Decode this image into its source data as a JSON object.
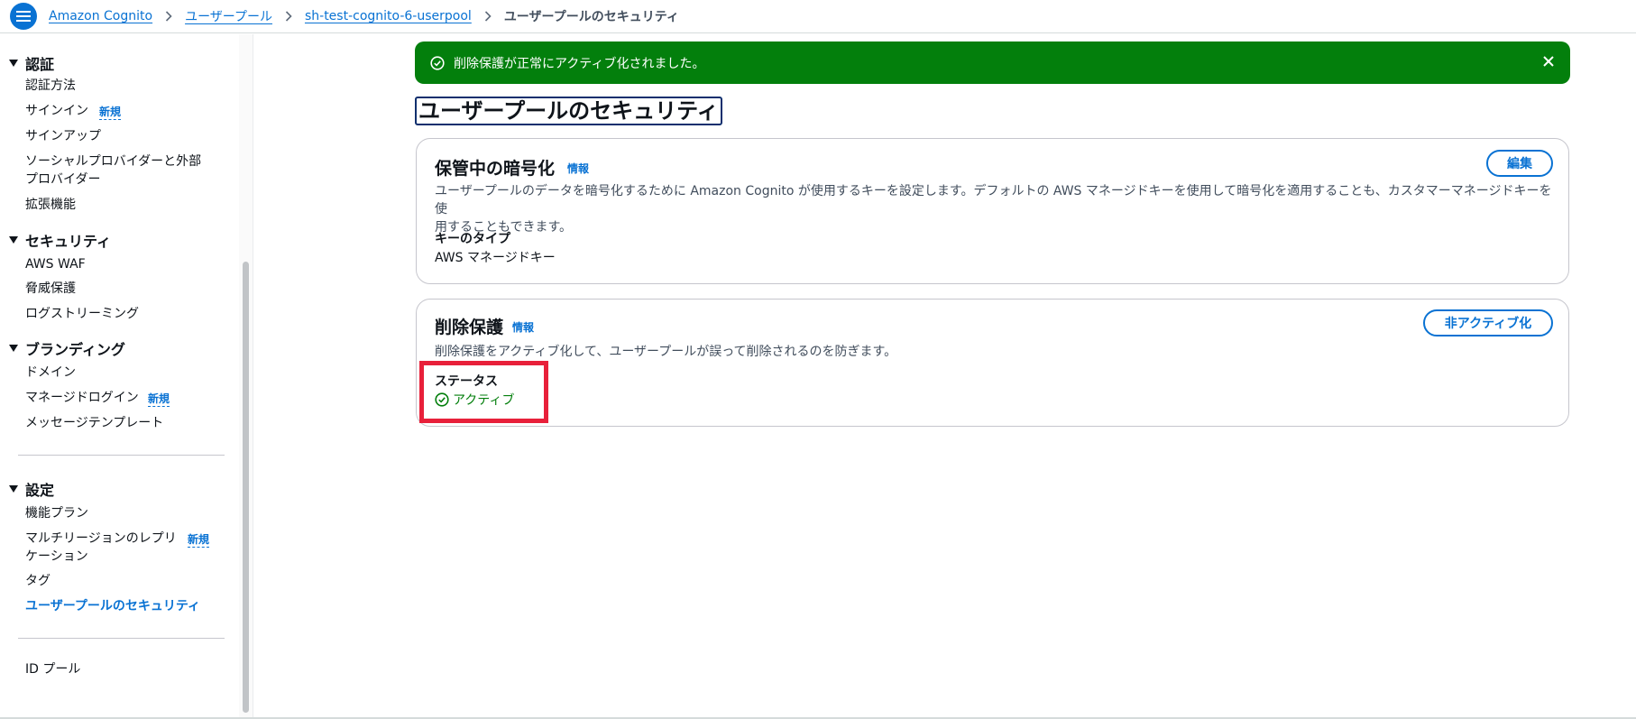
{
  "breadcrumb": {
    "items": [
      "Amazon Cognito",
      "ユーザープール",
      "sh-test-cognito-6-userpool"
    ],
    "current": "ユーザープールのセキュリティ"
  },
  "sidebar": {
    "sections": [
      {
        "title": "認証",
        "items": [
          "認証方法",
          "サインイン",
          "サインアップ",
          "ソーシャルプロバイダーと外部",
          "プロバイダー",
          "拡張機能"
        ]
      },
      {
        "title": "セキュリティ",
        "items": [
          "AWS WAF",
          "脅威保護",
          "ログストリーミング"
        ]
      },
      {
        "title": "ブランディング",
        "items": [
          "ドメイン",
          "マネージドログイン",
          "メッセージテンプレート"
        ]
      },
      {
        "title": "設定",
        "items": [
          "機能プラン",
          "マルチリージョンのレプリ",
          "ケーション",
          "タグ",
          "ユーザープールのセキュリティ"
        ]
      }
    ],
    "id_pool": "ID プール",
    "new_badge": "新規"
  },
  "flash": {
    "message": "削除保護が正常にアクティブ化されました。"
  },
  "page_title": "ユーザープールのセキュリティ",
  "encryption": {
    "title": "保管中の暗号化",
    "info": "情報",
    "edit_label": "編集",
    "desc_line1": "ユーザープールのデータを暗号化するために Amazon Cognito が使用するキーを設定します。デフォルトの AWS マネージドキーを使用して暗号化を適用することも、カスタマーマネージドキーを使",
    "desc_line2": "用することもできます。",
    "key_type_label": "キーのタイプ",
    "key_type_value": "AWS マネージドキー"
  },
  "deletion": {
    "title": "削除保護",
    "info": "情報",
    "deactivate_label": "非アクティブ化",
    "desc": "削除保護をアクティブ化して、ユーザープールが誤って削除されるのを防ぎます。",
    "status_label": "ステータス",
    "status_value": "アクティブ"
  },
  "colors": {
    "accent": "#0972d3",
    "success": "#037f0c",
    "highlight": "#e8203a"
  }
}
